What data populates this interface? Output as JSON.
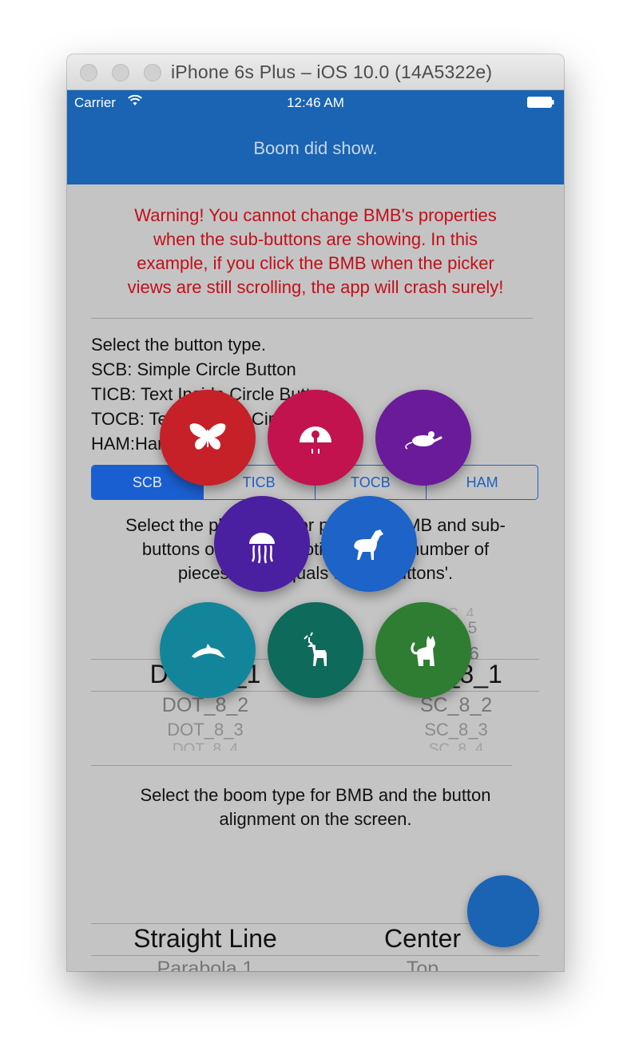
{
  "window": {
    "title": "iPhone 6s Plus – iOS 10.0 (14A5322e)"
  },
  "status_bar": {
    "carrier": "Carrier",
    "time": "12:46 AM",
    "wifi_icon": "wifi-icon",
    "battery_icon": "battery-icon"
  },
  "nav": {
    "title": "Boom did show."
  },
  "warning": {
    "lines": [
      "Warning! You cannot change BMB's properties",
      "when the sub-buttons are showing. In this",
      "example, if you click the BMB when the picker",
      "views are still scrolling, the app will crash surely!"
    ]
  },
  "button_type": {
    "lines": [
      "Select the button type.",
      "SCB: Simple Circle Button",
      "TICB: Text Inside Circle Button",
      "TOCB: Text Outside Circle Button",
      "HAM:Ham Button"
    ],
    "segments": [
      "SCB",
      "TICB",
      "TOCB",
      "HAM"
    ],
    "selected": "SCB"
  },
  "piece_place": {
    "lines": [
      "Select the place type for pieces of BMB and sub-",
      "buttons on screen. Notice that the number of",
      "pieces must equals to sub-buttons'."
    ],
    "picker": {
      "left": {
        "above": [
          "DOT_4",
          "DOT_5",
          "DOT_6"
        ],
        "selected": "DOT_8_1",
        "below": [
          "DOT_8_2",
          "DOT_8_3",
          "DOT_8_4"
        ]
      },
      "right": {
        "above": [
          "SC_4",
          "SC_5",
          "SC_6"
        ],
        "selected": "SC_8_1",
        "below": [
          "SC_8_2",
          "SC_8_3",
          "SC_8_4"
        ]
      }
    }
  },
  "boom_type": {
    "lines": [
      "Select the boom type for BMB and the button",
      "alignment on the screen."
    ],
    "picker": {
      "left": {
        "selected": "Straight Line",
        "below": [
          "Parabola 1"
        ]
      },
      "right": {
        "selected": "Center",
        "below": [
          "Top"
        ]
      }
    }
  },
  "sub_buttons": [
    {
      "icon": "butterfly-icon",
      "color": "#c62128"
    },
    {
      "icon": "peacock-icon",
      "color": "#c2134f"
    },
    {
      "icon": "mouse-icon",
      "color": "#6a1b9a"
    },
    {
      "icon": "jellyfish-icon",
      "color": "#4a1fa0"
    },
    {
      "icon": "horse-icon",
      "color": "#1d63c8"
    },
    {
      "icon": "dolphin-icon",
      "color": "#13859a"
    },
    {
      "icon": "deer-icon",
      "color": "#0e6a5a"
    },
    {
      "icon": "cat-icon",
      "color": "#2e7d32"
    }
  ],
  "bmb": {
    "color": "#1a64b3"
  }
}
